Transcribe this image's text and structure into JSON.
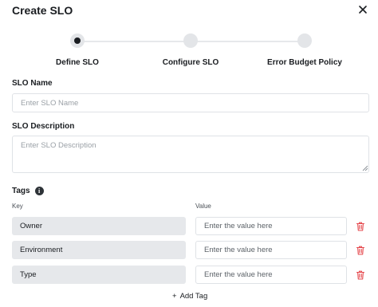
{
  "dialog": {
    "title": "Create SLO"
  },
  "stepper": {
    "steps": [
      {
        "label": "Define SLO",
        "active": true
      },
      {
        "label": "Configure SLO",
        "active": false
      },
      {
        "label": "Error Budget Policy",
        "active": false
      }
    ]
  },
  "form": {
    "name": {
      "label": "SLO Name",
      "placeholder": "Enter SLO Name",
      "value": ""
    },
    "description": {
      "label": "SLO Description",
      "placeholder": "Enter SLO Description",
      "value": ""
    },
    "tags": {
      "label": "Tags",
      "info_icon": "info-icon",
      "key_header": "Key",
      "value_header": "Value",
      "rows": [
        {
          "key": "Owner",
          "value_placeholder": "Enter the value here"
        },
        {
          "key": "Environment",
          "value_placeholder": "Enter the value here"
        },
        {
          "key": "Type",
          "value_placeholder": "Enter the value here"
        }
      ],
      "add_label": "Add Tag",
      "add_icon": "+"
    }
  },
  "colors": {
    "delete_icon": "#e5484d",
    "key_bg": "#e6e8eb",
    "step_inactive": "#e3e5e8",
    "text": "#1a1d21"
  }
}
